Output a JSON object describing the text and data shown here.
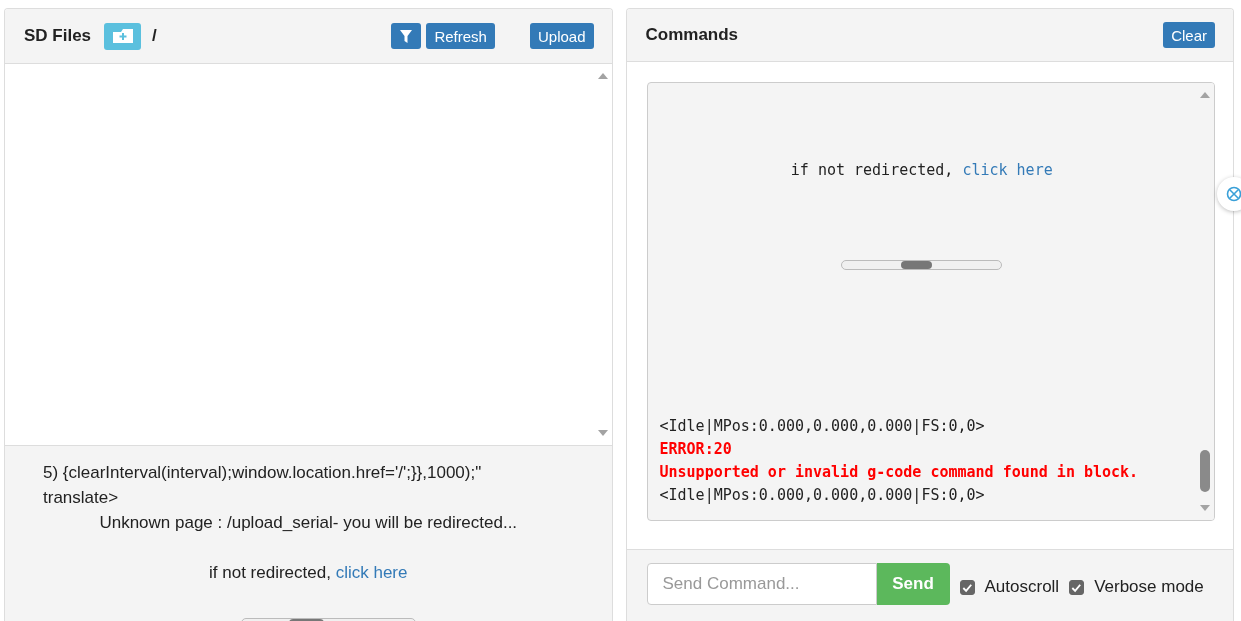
{
  "sd_files": {
    "title": "SD Files",
    "path": "/",
    "buttons": [
      {
        "label": "Refresh"
      },
      {
        "label": "Upload"
      }
    ],
    "preview": {
      "code_line": "5) {clearInterval(interval);window.location.href='/';}},1000);\"",
      "tag_line": "translate>",
      "message": "Unknown page : /upload_serial- you will be redirected...",
      "notice": {
        "text": "if not redirected, ",
        "link": "click here"
      }
    }
  },
  "commands": {
    "title": "Commands",
    "clear_button": "Clear",
    "console": {
      "notice": {
        "text": "if not redirected, ",
        "link": "click here"
      },
      "lines": [
        {
          "text": "<Idle|MPos:0.000,0.000,0.000|FS:0,0>",
          "kind": "status"
        },
        {
          "text": "ERROR:20",
          "kind": "error"
        },
        {
          "text": "Unsupported or invalid g-code command found in block.",
          "kind": "error"
        },
        {
          "text": "<Idle|MPos:0.000,0.000,0.000|FS:0,0>",
          "kind": "status"
        }
      ]
    },
    "command_input": {
      "placeholder": "Send Command..."
    },
    "send_button": "Send",
    "options": [
      {
        "label": "Autoscroll",
        "checked": true
      },
      {
        "label": "Verbose mode",
        "checked": true
      }
    ]
  }
}
